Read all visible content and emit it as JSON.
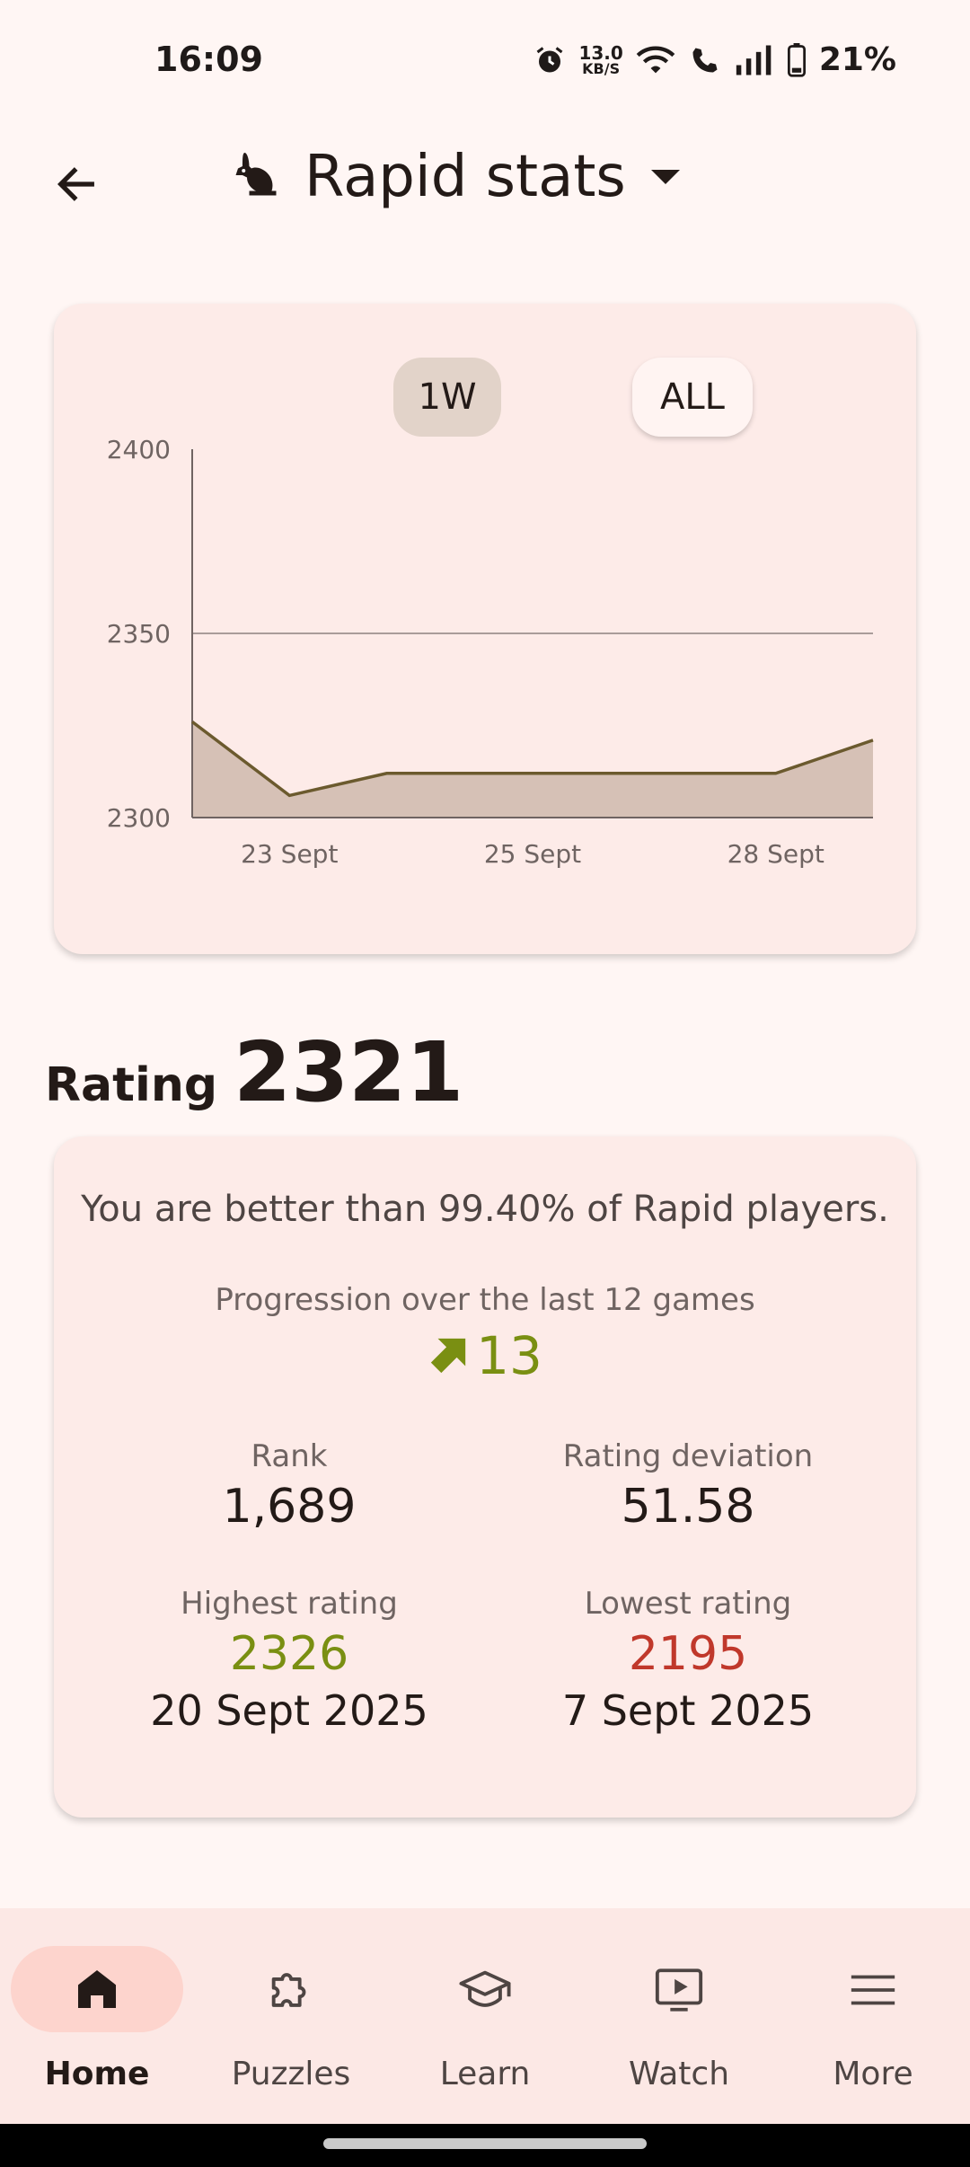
{
  "status_bar": {
    "time": "16:09",
    "net_speed_value": "13.0",
    "net_speed_unit": "KB/S",
    "battery": "21%"
  },
  "app_bar": {
    "title": "Rapid stats",
    "title_icon": "rabbit-icon"
  },
  "chart": {
    "range_buttons": {
      "one_week": "1W",
      "all": "ALL"
    },
    "selected_range": "1W"
  },
  "chart_data": {
    "type": "area",
    "x_tick_labels": [
      "23 Sept",
      "25 Sept",
      "28 Sept"
    ],
    "y_tick_labels": [
      "2400",
      "2350",
      "2300"
    ],
    "ylim": [
      2300,
      2400
    ],
    "grid": "horizontal line at 2350",
    "series": [
      {
        "points": [
          {
            "x": 0.0,
            "y": 2326
          },
          {
            "x": 1.0,
            "y": 2306
          },
          {
            "x": 2.0,
            "y": 2312
          },
          {
            "x": 3.0,
            "y": 2312
          },
          {
            "x": 4.0,
            "y": 2312
          },
          {
            "x": 5.0,
            "y": 2312
          },
          {
            "x": 6.0,
            "y": 2312
          },
          {
            "x": 7.0,
            "y": 2321
          }
        ]
      }
    ],
    "x_tick_positions": [
      1.0,
      3.5,
      6.0
    ],
    "colors": {
      "line": "#6b5a2e",
      "fill": "#d6c1b6",
      "axis": "#6f6462"
    }
  },
  "rating": {
    "label": "Rating",
    "value": "2321"
  },
  "stats": {
    "better_than": "You are better than 99.40% of Rapid players.",
    "progression_label": "Progression over the last 12 games",
    "progression_value": "13",
    "rank_label": "Rank",
    "rank_value": "1,689",
    "deviation_label": "Rating deviation",
    "deviation_value": "51.58",
    "highest_label": "Highest rating",
    "highest_value": "2326",
    "highest_date": "20 Sept 2025",
    "lowest_label": "Lowest rating",
    "lowest_value": "2195",
    "lowest_date": "7 Sept 2025"
  },
  "nav": {
    "items": [
      {
        "label": "Home",
        "icon": "home-icon",
        "active": true
      },
      {
        "label": "Puzzles",
        "icon": "puzzle-icon",
        "active": false
      },
      {
        "label": "Learn",
        "icon": "graduation-cap-icon",
        "active": false
      },
      {
        "label": "Watch",
        "icon": "tv-play-icon",
        "active": false
      },
      {
        "label": "More",
        "icon": "menu-icon",
        "active": false
      }
    ]
  },
  "colors": {
    "background": "#fff6f4",
    "card": "#fdebe8",
    "positive": "#7a8f12",
    "negative": "#c0382b",
    "nav_active": "#fdd4cd"
  }
}
